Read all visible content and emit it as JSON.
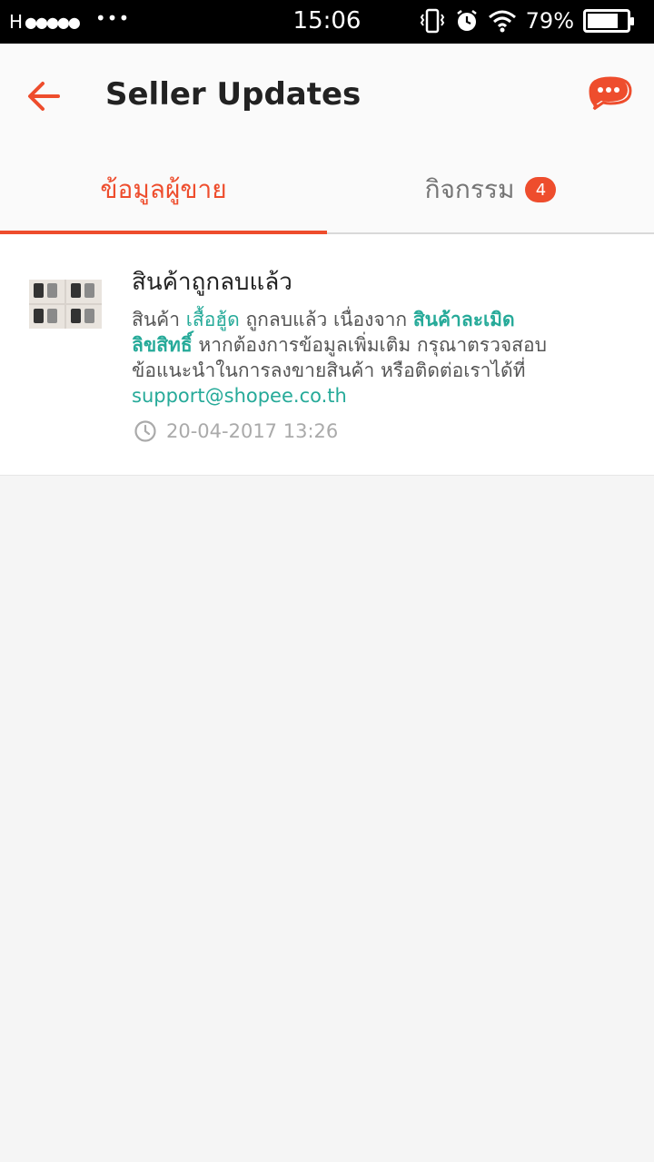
{
  "status_bar": {
    "carrier": "H",
    "signal_dots": "●●●●●",
    "more": "•••",
    "time": "15:06",
    "battery_percent": "79%",
    "battery_level": 0.79,
    "icons": [
      "vibrate-icon",
      "alarm-icon",
      "wifi-icon",
      "battery-icon"
    ]
  },
  "app_bar": {
    "title": "Seller Updates",
    "back_icon": "arrow-left-icon",
    "chat_icon": "chat-bubble-icon",
    "accent_color": "#ee4d2d"
  },
  "tabs": [
    {
      "label": "ข้อมูลผู้ขาย",
      "active": true
    },
    {
      "label": "กิจกรรม",
      "active": false,
      "badge": "4"
    }
  ],
  "notification": {
    "title": "สินค้าถูกลบแล้ว",
    "body_parts": {
      "p1": "สินค้า ",
      "product": "เสื้อฮู้ด",
      "p2": " ถูกลบแล้ว เนื่องจาก ",
      "reason": "สินค้าละเมิดลิขสิทธิ์",
      "p3": " หากต้องการข้อมูลเพิ่มเติม กรุณาตรวจสอบข้อแนะนำในการลงขายสินค้า หรือติดต่อเราได้ที่ ",
      "email": "support@shopee.co.th"
    },
    "timestamp": "20-04-2017 13:26",
    "link_color": "#26aa99"
  }
}
